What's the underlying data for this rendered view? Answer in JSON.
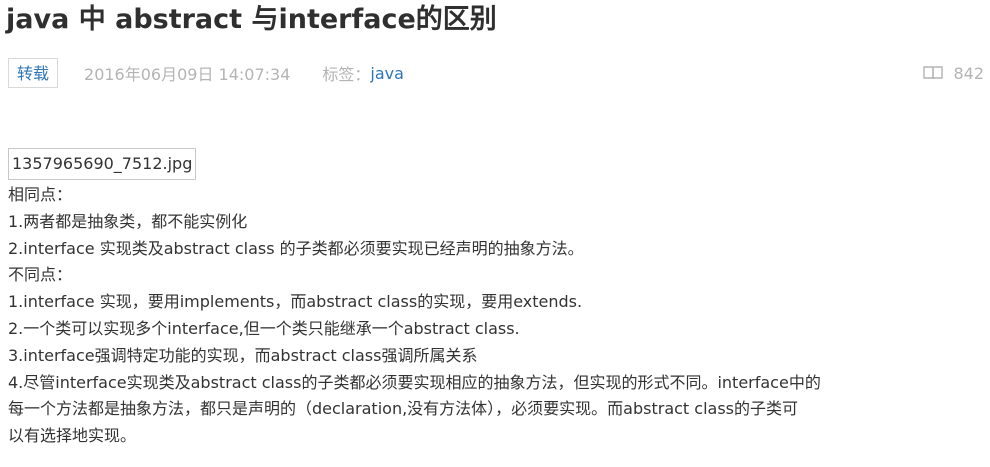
{
  "article": {
    "title": "java 中 abstract 与interface的区别",
    "badge": "转载",
    "date": "2016年06月09日 14:07:34",
    "tag_label": "标签：",
    "tag_value": "java",
    "views": "842",
    "views_icon": "book-icon"
  },
  "content": {
    "image_alt": "1357965690_7512.jpg",
    "lines": [
      "相同点：",
      "1.两者都是抽象类，都不能实例化",
      "2.interface 实现类及abstract class 的子类都必须要实现已经声明的抽象方法。",
      "不同点：",
      "1.interface 实现，要用implements，而abstract class的实现，要用extends.",
      "2.一个类可以实现多个interface,但一个类只能继承一个abstract class.",
      "3.interface强调特定功能的实现，而abstract class强调所属关系",
      "4.尽管interface实现类及abstract class的子类都必须要实现相应的抽象方法，但实现的形式不同。interface中的",
      "每一个方法都是抽象方法，都只是声明的（declaration,没有方法体），必须要实现。而abstract class的子类可",
      "以有选择地实现。"
    ]
  }
}
